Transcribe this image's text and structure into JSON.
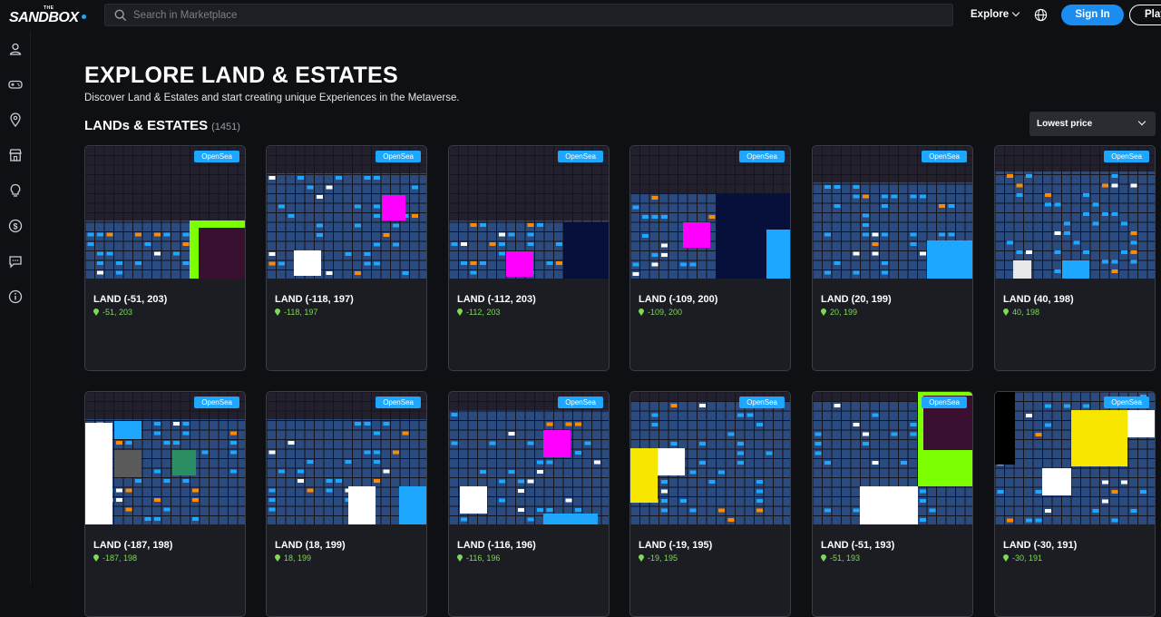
{
  "header": {
    "logo_top": "THE",
    "logo_text": "SANDBOX",
    "search_placeholder": "Search in Marketplace",
    "explore_label": "Explore",
    "signin_label": "Sign In",
    "play_label": "Play"
  },
  "sidebar": {
    "icons": [
      "user-icon",
      "gamepad-icon",
      "location-pin-icon",
      "store-icon",
      "lightbulb-icon",
      "dollar-icon",
      "chat-icon",
      "info-icon"
    ]
  },
  "page": {
    "title": "EXPLORE LAND & ESTATES",
    "subtitle": "Discover Land & Estates and start creating unique Experiences in the Metaverse.",
    "section_label": "LANDs & ESTATES",
    "section_count": "(1451)",
    "sort_value": "Lowest price"
  },
  "badge_label": "OpenSea",
  "cards": [
    {
      "name": "LAND (-51, 203)",
      "coords": "-51, 203"
    },
    {
      "name": "LAND (-118, 197)",
      "coords": "-118, 197"
    },
    {
      "name": "LAND (-112, 203)",
      "coords": "-112, 203"
    },
    {
      "name": "LAND (-109, 200)",
      "coords": "-109, 200"
    },
    {
      "name": "LAND (20, 199)",
      "coords": "20, 199"
    },
    {
      "name": "LAND (40, 198)",
      "coords": "40, 198"
    },
    {
      "name": "LAND (-187, 198)",
      "coords": "-187, 198"
    },
    {
      "name": "LAND (18, 199)",
      "coords": "18, 199"
    },
    {
      "name": "LAND (-116, 196)",
      "coords": "-116, 196"
    },
    {
      "name": "LAND (-19, 195)",
      "coords": "-19, 195"
    },
    {
      "name": "LAND (-51, 193)",
      "coords": "-51, 193"
    },
    {
      "name": "LAND (-30, 191)",
      "coords": "-30, 191"
    }
  ],
  "colors": {
    "accent_blue": "#1ea7ff",
    "map_blue": "#2b4a7d",
    "coord_green": "#7ed957",
    "magenta": "#ff00ff",
    "lime": "#7cff00"
  }
}
